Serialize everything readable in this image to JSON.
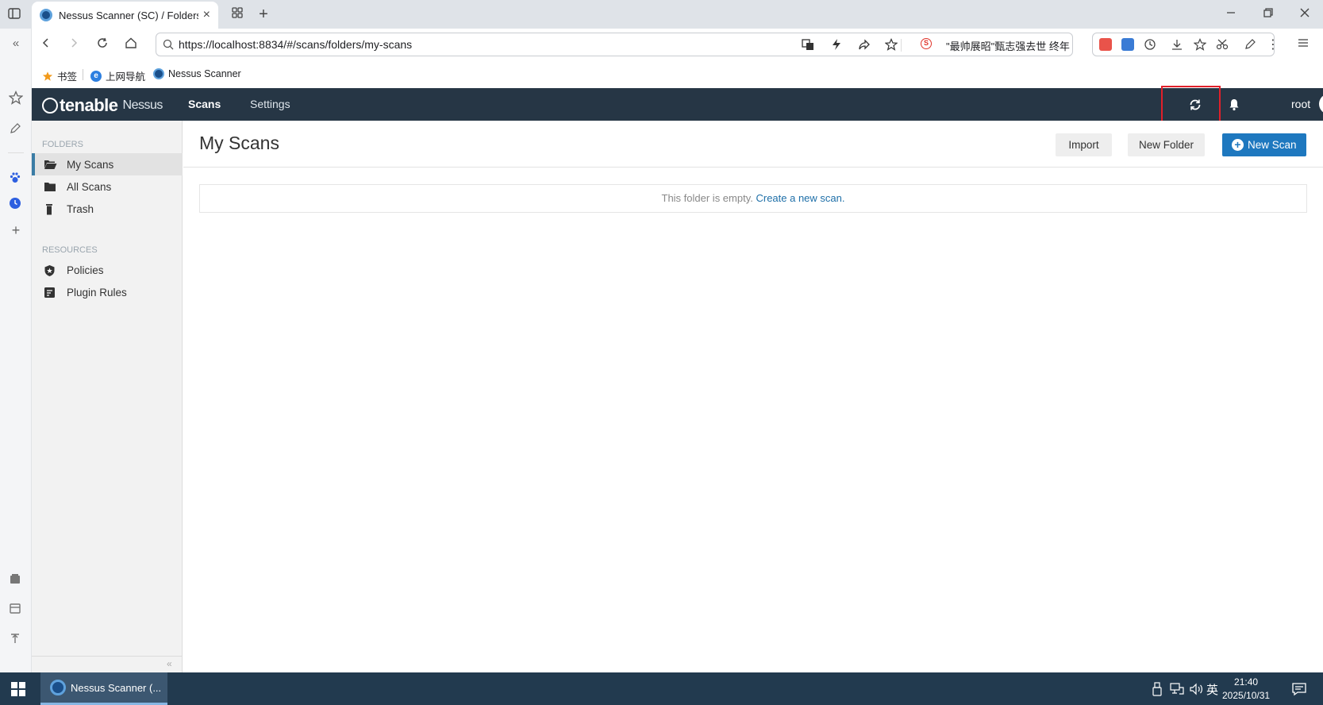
{
  "browser": {
    "tab_title": "Nessus Scanner (SC) / Folders / My Scans",
    "url": "https://localhost:8834/#/scans/folders/my-scans",
    "news_text": "\"最帅展昭\"甄志强去世 终年",
    "bookmarks": [
      {
        "label": "书签"
      },
      {
        "label": "上网导航"
      },
      {
        "label": "Nessus Scanner"
      }
    ]
  },
  "nessus": {
    "logo_brand": "tenable",
    "logo_product": "Nessus",
    "nav": {
      "scans": "Scans",
      "settings": "Settings"
    },
    "user": "root",
    "sidebar": {
      "folders_heading": "FOLDERS",
      "folders": [
        {
          "label": "My Scans",
          "active": true
        },
        {
          "label": "All Scans",
          "active": false
        },
        {
          "label": "Trash",
          "active": false
        }
      ],
      "resources_heading": "RESOURCES",
      "resources": [
        {
          "label": "Policies"
        },
        {
          "label": "Plugin Rules"
        }
      ]
    },
    "page_title": "My Scans",
    "buttons": {
      "import": "Import",
      "new_folder": "New Folder",
      "new_scan": "New Scan"
    },
    "empty_text": "This folder is empty.",
    "empty_link": "Create a new scan."
  },
  "taskbar": {
    "app_label": "Nessus Scanner (...",
    "ime": "英",
    "time": "21:40",
    "date": "2025/10/31"
  },
  "colors": {
    "nessus_header": "#263645",
    "primary_button": "#1e78bf",
    "highlight_box": "#e0202a",
    "taskbar": "#223a4f"
  }
}
